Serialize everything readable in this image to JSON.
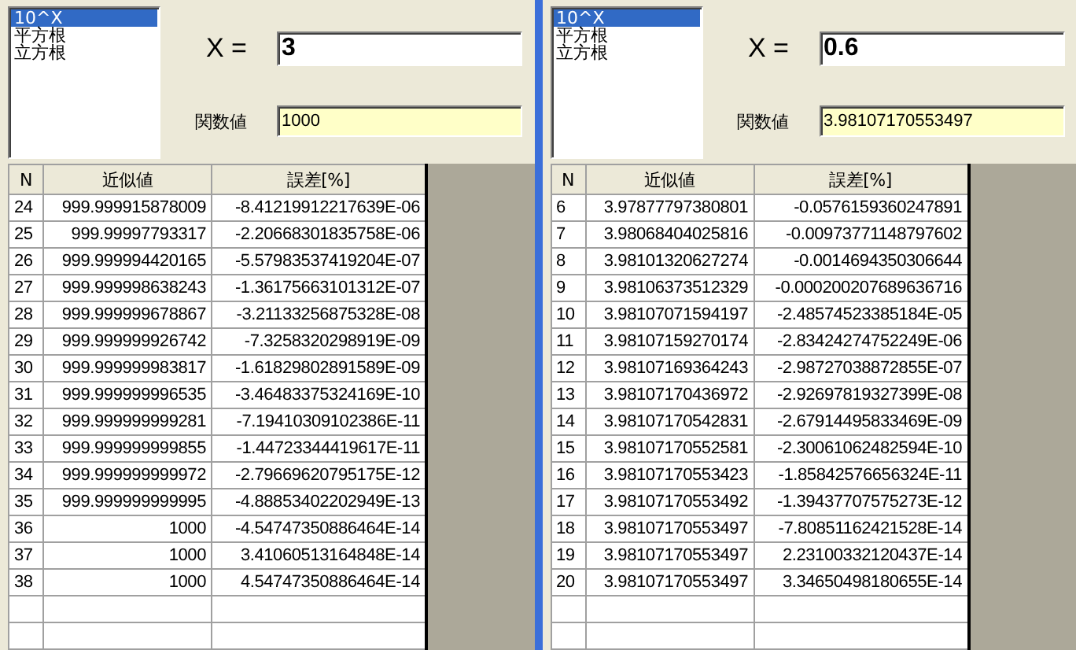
{
  "panels": [
    {
      "functions": [
        {
          "label": "10^X",
          "selected": true
        },
        {
          "label": "平方根",
          "selected": false
        },
        {
          "label": "立方根",
          "selected": false
        }
      ],
      "x_label": "X =",
      "x_value": "3",
      "result_label": "関数値",
      "result_value": "1000",
      "table": {
        "columns": [
          "N",
          "近似値",
          "誤差[%]"
        ],
        "rows": [
          [
            "24",
            "999.999915878009",
            "-8.41219912217639E-06"
          ],
          [
            "25",
            "999.99997793317",
            "-2.20668301835758E-06"
          ],
          [
            "26",
            "999.999994420165",
            "-5.57983537419204E-07"
          ],
          [
            "27",
            "999.999998638243",
            "-1.36175663101312E-07"
          ],
          [
            "28",
            "999.999999678867",
            "-3.21133256875328E-08"
          ],
          [
            "29",
            "999.999999926742",
            "-7.3258320298919E-09"
          ],
          [
            "30",
            "999.999999983817",
            "-1.61829802891589E-09"
          ],
          [
            "31",
            "999.999999996535",
            "-3.46483375324169E-10"
          ],
          [
            "32",
            "999.999999999281",
            "-7.19410309102386E-11"
          ],
          [
            "33",
            "999.999999999855",
            "-1.44723344419617E-11"
          ],
          [
            "34",
            "999.999999999972",
            "-2.79669620795175E-12"
          ],
          [
            "35",
            "999.999999999995",
            "-4.88853402202949E-13"
          ],
          [
            "36",
            "1000",
            "-4.54747350886464E-14"
          ],
          [
            "37",
            "1000",
            "3.41060513164848E-14"
          ],
          [
            "38",
            "1000",
            "4.54747350886464E-14"
          ]
        ]
      }
    },
    {
      "functions": [
        {
          "label": "10^X",
          "selected": true
        },
        {
          "label": "平方根",
          "selected": false
        },
        {
          "label": "立方根",
          "selected": false
        }
      ],
      "x_label": "X =",
      "x_value": "0.6",
      "result_label": "関数値",
      "result_value": "3.98107170553497",
      "table": {
        "columns": [
          "N",
          "近似値",
          "誤差[%]"
        ],
        "rows": [
          [
            "6",
            "3.97877797380801",
            "-0.0576159360247891"
          ],
          [
            "7",
            "3.98068404025816",
            "-0.00973771148797602"
          ],
          [
            "8",
            "3.98101320627274",
            "-0.0014694350306644"
          ],
          [
            "9",
            "3.98106373512329",
            "-0.000200207689636716"
          ],
          [
            "10",
            "3.98107071594197",
            "-2.48574523385184E-05"
          ],
          [
            "11",
            "3.98107159270174",
            "-2.83424274752249E-06"
          ],
          [
            "12",
            "3.98107169364243",
            "-2.98727038872855E-07"
          ],
          [
            "13",
            "3.98107170436972",
            "-2.92697819327399E-08"
          ],
          [
            "14",
            "3.98107170542831",
            "-2.67914495833469E-09"
          ],
          [
            "15",
            "3.98107170552581",
            "-2.30061062482594E-10"
          ],
          [
            "16",
            "3.98107170553423",
            "-1.85842576656324E-11"
          ],
          [
            "17",
            "3.98107170553492",
            "-1.39437707575273E-12"
          ],
          [
            "18",
            "3.98107170553497",
            "-7.80851162421528E-14"
          ],
          [
            "19",
            "3.98107170553497",
            "2.23100332120437E-14"
          ],
          [
            "20",
            "3.98107170553497",
            "3.34650498180655E-14"
          ]
        ]
      }
    }
  ]
}
